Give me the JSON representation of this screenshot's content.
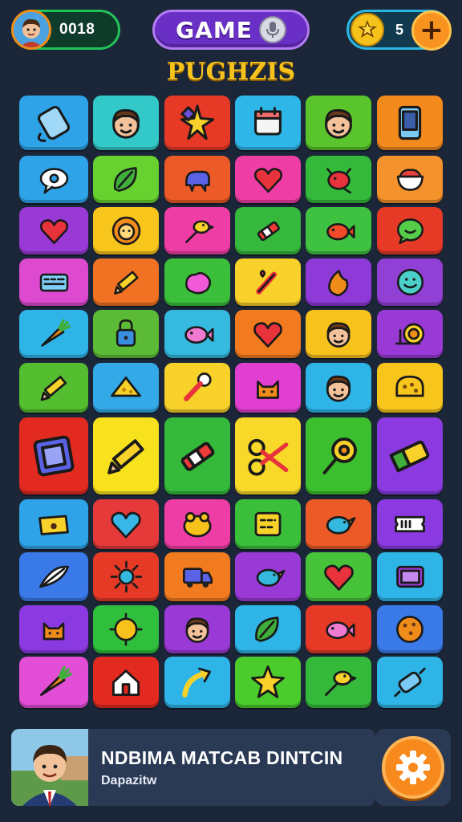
{
  "header": {
    "score": "0018",
    "title": "GAME",
    "coins": "5",
    "plus": "+",
    "subtitle": "PUGHZIS"
  },
  "grid": {
    "rows": [
      [
        {
          "color": "#2ea3e8",
          "icon": "phone-plug-icon"
        },
        {
          "color": "#33c9c9",
          "icon": "boy-face-icon"
        },
        {
          "color": "#e63a27",
          "icon": "sparkle-star-icon"
        },
        {
          "color": "#2fb6e8",
          "icon": "calendar-icon"
        },
        {
          "color": "#59c42b",
          "icon": "boy-face-icon"
        },
        {
          "color": "#f38a1e",
          "icon": "smartphone-icon"
        }
      ],
      [
        {
          "color": "#2ea3e8",
          "icon": "eye-bubble-icon"
        },
        {
          "color": "#67d12f",
          "icon": "leaf-icon"
        },
        {
          "color": "#ec5a27",
          "icon": "blue-splash-icon"
        },
        {
          "color": "#ee3ea6",
          "icon": "heart-icon"
        },
        {
          "color": "#34b93a",
          "icon": "red-bug-icon"
        },
        {
          "color": "#f4922b",
          "icon": "bowl-icon"
        }
      ],
      [
        {
          "color": "#9a3ad6",
          "icon": "heart-icon"
        },
        {
          "color": "#f8c51d",
          "icon": "lion-icon"
        },
        {
          "color": "#ee3ea6",
          "icon": "bird-wand-icon"
        },
        {
          "color": "#35b83c",
          "icon": "crayon-icon"
        },
        {
          "color": "#3fc241",
          "icon": "red-fish-icon"
        },
        {
          "color": "#e63a27",
          "icon": "chat-bubble-icon"
        }
      ],
      [
        {
          "color": "#dd4ad0",
          "icon": "keyboard-icon"
        },
        {
          "color": "#f07222",
          "icon": "pencil-icon"
        },
        {
          "color": "#3bbf3a",
          "icon": "pink-blob-icon"
        },
        {
          "color": "#f8d12a",
          "icon": "brush-icon"
        },
        {
          "color": "#8e3ad8",
          "icon": "flame-icon"
        },
        {
          "color": "#9140d6",
          "icon": "smiley-icon"
        }
      ],
      [
        {
          "color": "#2eb4e6",
          "icon": "carrot-icon"
        },
        {
          "color": "#5bbb36",
          "icon": "lock-icon"
        },
        {
          "color": "#35b9de",
          "icon": "pink-fish-icon"
        },
        {
          "color": "#f37b1f",
          "icon": "heart-icon"
        },
        {
          "color": "#f8c21c",
          "icon": "boy-face-icon"
        },
        {
          "color": "#9a3ad6",
          "icon": "snail-icon"
        }
      ],
      [
        {
          "color": "#54bd30",
          "icon": "pencil-icon"
        },
        {
          "color": "#34a9e8",
          "icon": "cheese-icon"
        },
        {
          "color": "#f8d12a",
          "icon": "microphone-icon"
        },
        {
          "color": "#e03fd0",
          "icon": "cat-icon"
        },
        {
          "color": "#2eb4e6",
          "icon": "boy-face-icon"
        },
        {
          "color": "#f8c51d",
          "icon": "bread-icon"
        }
      ],
      [
        {
          "color": "#e22a20",
          "icon": "photo-frame-icon"
        },
        {
          "color": "#f8e21d",
          "icon": "pencil-icon"
        },
        {
          "color": "#34b93a",
          "icon": "crayon-icon"
        },
        {
          "color": "#f8d92a",
          "icon": "scissors-icon"
        },
        {
          "color": "#3cbf2e",
          "icon": "flower-wand-icon"
        },
        {
          "color": "#8a3ae0",
          "icon": "eraser-icon"
        }
      ],
      [
        {
          "color": "#2ea3e8",
          "icon": "cheese-block-icon"
        },
        {
          "color": "#e63a3a",
          "icon": "blue-heart-icon"
        },
        {
          "color": "#ee3ea6",
          "icon": "frog-icon"
        },
        {
          "color": "#3bbf3a",
          "icon": "calculator-icon"
        },
        {
          "color": "#ec5a27",
          "icon": "bird-icon"
        },
        {
          "color": "#8a3ae0",
          "icon": "ticket-icon"
        }
      ],
      [
        {
          "color": "#3a7ae8",
          "icon": "feather-icon"
        },
        {
          "color": "#e63a27",
          "icon": "sun-star-icon"
        },
        {
          "color": "#f37b1f",
          "icon": "truck-icon"
        },
        {
          "color": "#9a3ad6",
          "icon": "bird-icon"
        },
        {
          "color": "#47c33a",
          "icon": "heart-icon"
        },
        {
          "color": "#2eb4e6",
          "icon": "tv-icon"
        }
      ],
      [
        {
          "color": "#8a3ae0",
          "icon": "cat-icon"
        },
        {
          "color": "#2fbf3c",
          "icon": "sun-icon"
        },
        {
          "color": "#9a3ad6",
          "icon": "boy-face-icon"
        },
        {
          "color": "#2eb4e6",
          "icon": "leaf-icon"
        },
        {
          "color": "#e63a27",
          "icon": "pink-fish-icon"
        },
        {
          "color": "#3a7ae8",
          "icon": "cookie-icon"
        }
      ],
      [
        {
          "color": "#e34ed6",
          "icon": "carrot-icon"
        },
        {
          "color": "#e22a20",
          "icon": "house-icon"
        },
        {
          "color": "#2eb4e6",
          "icon": "arrow-icon"
        },
        {
          "color": "#4ccb2c",
          "icon": "star-icon"
        },
        {
          "color": "#34b93a",
          "icon": "bird-wand-icon"
        },
        {
          "color": "#2eb4e6",
          "icon": "rolling-pin-icon"
        }
      ]
    ]
  },
  "footer": {
    "title": "NDBIMA MATCAB DINTCIN",
    "subtitle": "Dapazitw"
  }
}
